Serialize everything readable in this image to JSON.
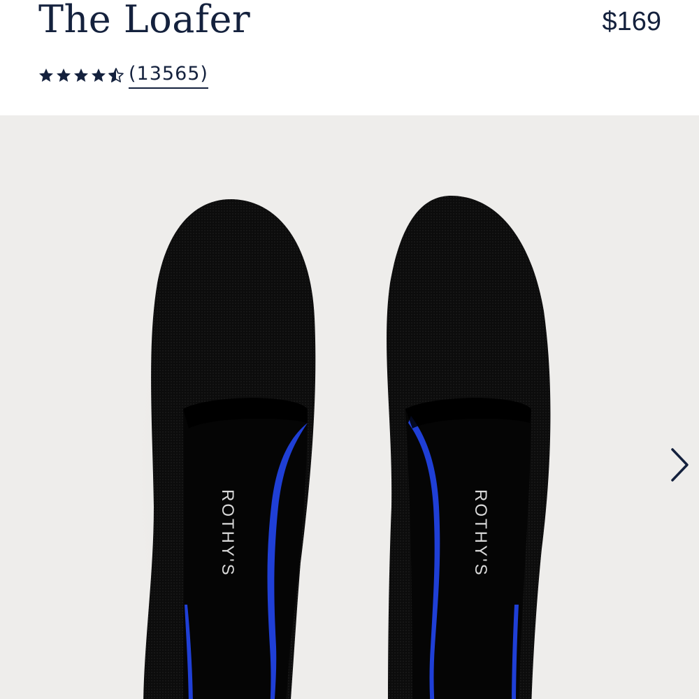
{
  "product": {
    "title": "The Loafer",
    "price": "$169"
  },
  "rating": {
    "value": 4.5,
    "max": 5,
    "review_count_label": "(13565)"
  },
  "gallery": {
    "insole_brand_text": "ROTHY'S",
    "next_icon": "chevron-right-icon",
    "background_color": "#eeedeb",
    "accent_color": "#1f3fd6"
  },
  "colors": {
    "brand_text": "#14213d"
  }
}
